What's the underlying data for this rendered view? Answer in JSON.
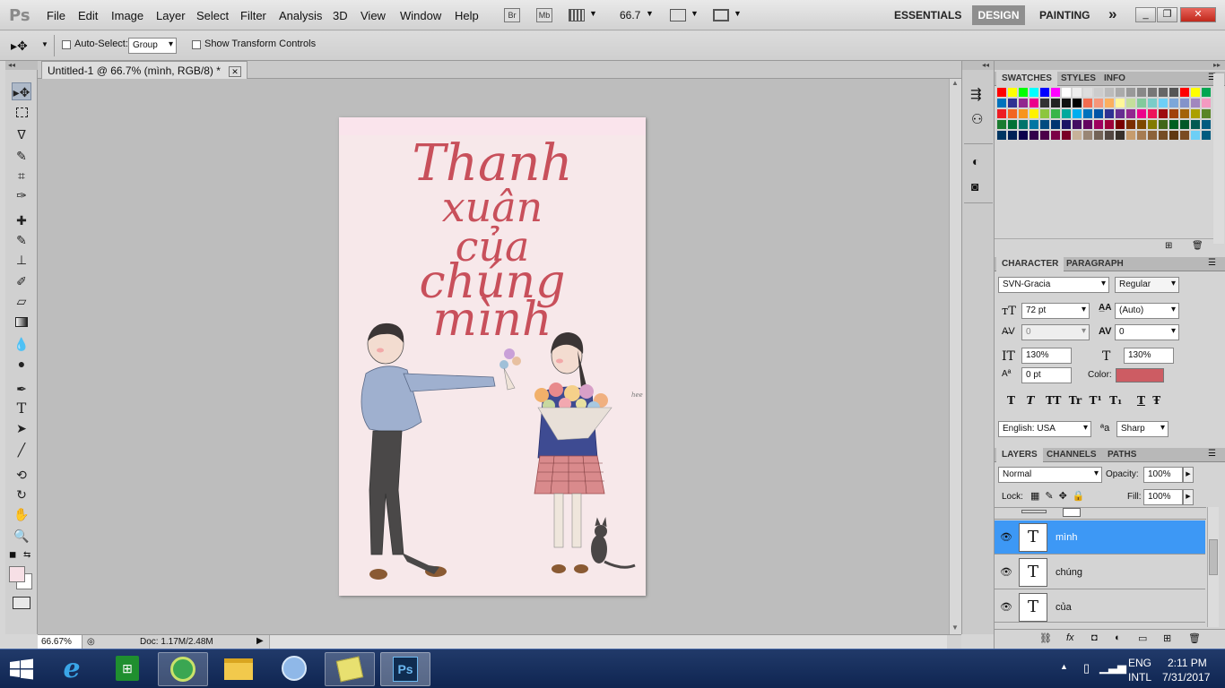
{
  "app": {
    "logo": "Ps",
    "zoom_box": "66.7",
    "br_label": "Br",
    "mb_label": "Mb"
  },
  "menu": [
    "File",
    "Edit",
    "Image",
    "Layer",
    "Select",
    "Filter",
    "Analysis",
    "3D",
    "View",
    "Window",
    "Help"
  ],
  "workspaces": {
    "essentials": "ESSENTIALS",
    "design": "DESIGN",
    "painting": "PAINTING",
    "more": "»"
  },
  "options": {
    "auto_select": "Auto-Select:",
    "group": "Group",
    "transform": "Show Transform Controls"
  },
  "document": {
    "tab_title": "Untitled-1 @ 66.7% (mình, RGB/8) *",
    "lines": [
      "Thanh",
      "xuân",
      "của",
      "chúng",
      "mình"
    ],
    "signature": "hee"
  },
  "status": {
    "zoom": "66.67%",
    "doc": "Doc: 1.17M/2.48M"
  },
  "swatches_tabs": [
    "SWATCHES",
    "STYLES",
    "INFO"
  ],
  "swatch_colors": [
    "#ff0000",
    "#ffff00",
    "#00ff00",
    "#00ffff",
    "#0000ff",
    "#ff00ff",
    "#ffffff",
    "#eeeeee",
    "#dddddd",
    "#cccccc",
    "#bbbbbb",
    "#aaaaaa",
    "#999999",
    "#888888",
    "#777777",
    "#666666",
    "#555555",
    "#ff0000",
    "#ffff00",
    "#00a651",
    "#0072bc",
    "#2e3192",
    "#92278f",
    "#ec008c",
    "#333333",
    "#222222",
    "#111111",
    "#000000",
    "#f26c4f",
    "#f69679",
    "#fbaf5d",
    "#fff799",
    "#c4df9b",
    "#82ca9c",
    "#7accc8",
    "#6dcff6",
    "#7da7d9",
    "#8393ca",
    "#a187be",
    "#f49ac1",
    "#ed1c24",
    "#f26522",
    "#f7941d",
    "#fff200",
    "#8dc63f",
    "#39b54a",
    "#00a99d",
    "#00aeef",
    "#0072bc",
    "#0054a6",
    "#2e3192",
    "#662d91",
    "#92278f",
    "#ec008c",
    "#ed145b",
    "#9e0b0f",
    "#a0410d",
    "#a36209",
    "#aba000",
    "#598527",
    "#1a7b30",
    "#007236",
    "#00746b",
    "#0076a3",
    "#004b80",
    "#003471",
    "#1b1464",
    "#440e62",
    "#630460",
    "#9e005d",
    "#9e0039",
    "#790000",
    "#7b2e00",
    "#7d4900",
    "#827b00",
    "#406618",
    "#005e20",
    "#005826",
    "#005952",
    "#005b7f",
    "#003663",
    "#002157",
    "#0d004c",
    "#32004b",
    "#4b0049",
    "#7b0046",
    "#7a0026",
    "#c7b299",
    "#998675",
    "#736357",
    "#534741",
    "#37302a",
    "#c69c6d",
    "#a67c52",
    "#8c6239",
    "#754c24",
    "#603913",
    "#7a4b22",
    "#6dcff6",
    "#005b7f"
  ],
  "character": {
    "tabs": [
      "CHARACTER",
      "PARAGRAPH"
    ],
    "font": "SVN-Gracia",
    "style": "Regular",
    "size": "72 pt",
    "leading": "(Auto)",
    "kerning": "0",
    "tracking": "0",
    "vscale": "130%",
    "hscale": "130%",
    "baseline": "0 pt",
    "color_label": "Color:",
    "color": "#cd5c63",
    "typo_buttons": [
      "T",
      "T",
      "TT",
      "Tr",
      "T¹",
      "T₁",
      "T",
      "Ŧ"
    ],
    "language": "English: USA",
    "aa_label": "ªa",
    "antialias": "Sharp"
  },
  "layers": {
    "tabs": [
      "LAYERS",
      "CHANNELS",
      "PATHS"
    ],
    "blend": "Normal",
    "opacity_label": "Opacity:",
    "opacity": "100%",
    "lock_label": "Lock:",
    "fill_label": "Fill:",
    "fill": "100%",
    "items": [
      {
        "name": "mình",
        "selected": true
      },
      {
        "name": "chúng",
        "selected": false
      },
      {
        "name": "của",
        "selected": false
      }
    ]
  },
  "taskbar": {
    "lang1": "ENG",
    "lang2": "INTL",
    "time": "2:11 PM",
    "date": "7/31/2017"
  }
}
